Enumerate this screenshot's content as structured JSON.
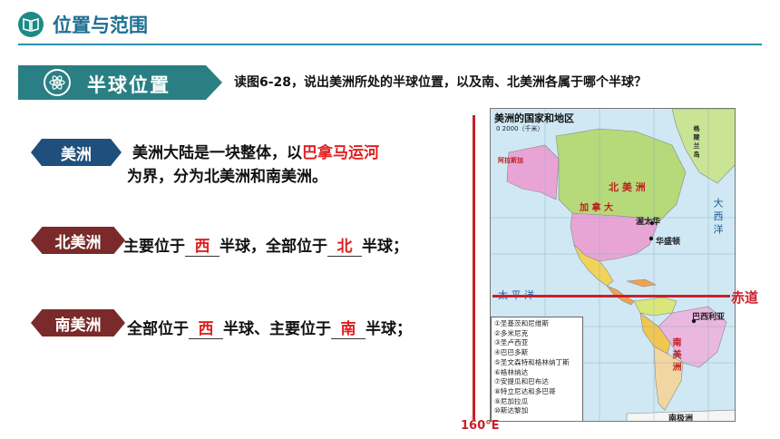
{
  "header": {
    "title": "位置与范围",
    "icon": "book-icon"
  },
  "banner": {
    "title": "半球位置",
    "icon": "atom-icon"
  },
  "question": "读图6-28，说出美洲所处的半球位置，以及南、北美洲各属于哪个半球？",
  "america": {
    "tag": "美洲",
    "line1_before": "美洲大陆是一块整体，以",
    "line1_highlight": "巴拿马运河",
    "line2": "为界，分为北美洲和南美洲。"
  },
  "north": {
    "tag": "北美洲",
    "t1": "主要位于",
    "a1": "西",
    "t2": "半球，全部位于",
    "a2": "北",
    "t3": "半球；"
  },
  "south": {
    "tag": "南美洲",
    "t1": "全部位于",
    "a1": "西",
    "t2": "半球、主要位于",
    "a2": "南",
    "t3": "半球；"
  },
  "map": {
    "title": "美洲的国家和地区",
    "scale": "0      2000（千米）",
    "legend": [
      "①圣基茨和尼维斯",
      "②多米尼克",
      "③圣卢西亚",
      "④巴巴多斯",
      "⑤圣文森特和格林纳丁斯",
      "⑥格林纳达",
      "⑦安提瓜和巴布达",
      "⑧特立尼达和多巴哥",
      "⑨尼加拉瓜",
      "⑩斯达黎加"
    ],
    "labels": {
      "north_america": "北 美 洲",
      "canada": "加 拿 大",
      "ottawa": "渥太华",
      "washington": "华盛顿",
      "greenland": "格 陵 兰 岛",
      "alaska": "阿拉斯加",
      "pacific": "太   平   洋",
      "atlantic": "大 西 洋",
      "brazil": "巴西利亚",
      "south_america": "南 美 洲",
      "antarctica": "南极洲"
    },
    "colors": {
      "ocean": "#cfe8f4",
      "canada": "#b6d97a",
      "usa": "#e9a4d6",
      "greenland": "#c9e494",
      "mexico": "#f2d35a",
      "central": "#f2a24e",
      "colombia": "#d9e67a",
      "brazil": "#e9b7e0",
      "peru": "#f0c650",
      "argentina": "#f2d6a2",
      "antarctica": "#f5f5f5"
    }
  },
  "equator_label": "赤道",
  "meridian_label": "160°E"
}
